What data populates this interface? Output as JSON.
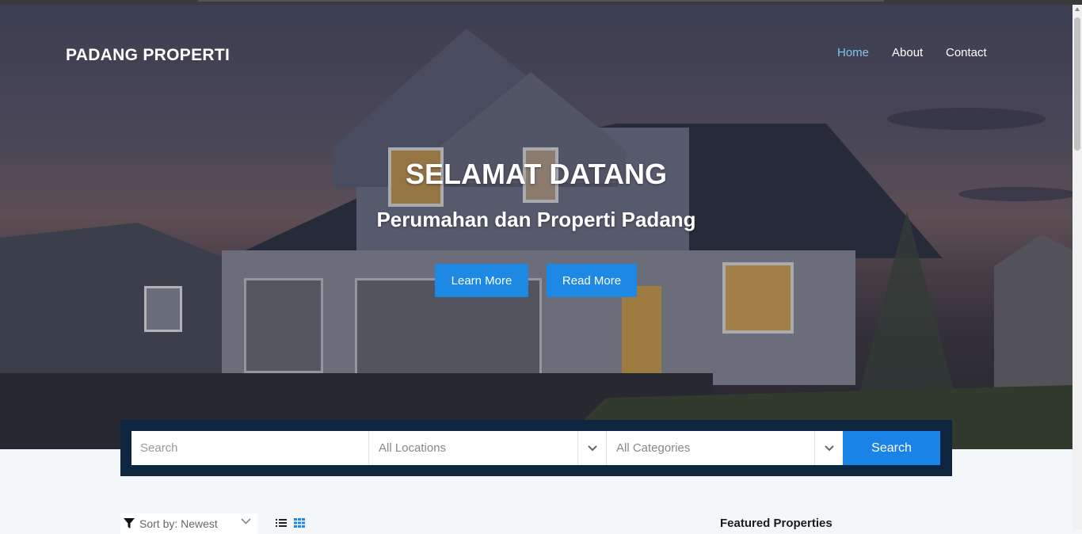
{
  "brand": "PADANG PROPERTI",
  "nav": {
    "home": "Home",
    "about": "About",
    "contact": "Contact"
  },
  "hero": {
    "title": "SELAMAT DATANG",
    "subtitle": "Perumahan dan Properti Padang",
    "learn_more": "Learn More",
    "read_more": "Read More"
  },
  "search": {
    "placeholder": "Search",
    "location": "All Locations",
    "category": "All Categories",
    "button": "Search"
  },
  "listing": {
    "sort": "Sort by: Newest",
    "featured_title": "Featured Properties"
  },
  "colors": {
    "accent": "#1e88e5",
    "nav_active": "#7fc4f5",
    "search_bg": "#0e2540"
  }
}
